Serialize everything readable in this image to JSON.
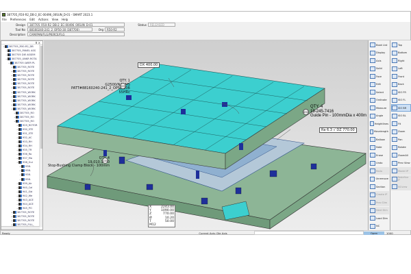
{
  "window": {
    "title": "387705_R50-R2_DB-2_EC-00496_00SUN_D-01 - SMART 2023.1"
  },
  "menu": [
    "File",
    "Preferences",
    "Edit",
    "Actions",
    "View",
    "Help"
  ],
  "form": {
    "design_label": "Design",
    "design": "387705_R50-R2_DB-2_EC-00496_00SUN_D-01",
    "toolno_label": "Tool No",
    "toolno": "88160240-241_2_OP50-30 (387700)",
    "org_label": "Org",
    "org": "R50-R2",
    "desc_label": "Description",
    "desc": "CAM/PAN/FLG/PIERCE/FLG",
    "status_label": "Status",
    "status": "RELEASED"
  },
  "tree": {
    "header": "⊼ ×",
    "items": [
      {
        "t": "387705_R50-R2_DB",
        "l": 0
      },
      {
        "t": "387705_PANEL ASS",
        "l": 1
      },
      {
        "t": "387705 DIE ASSEM",
        "l": 1
      },
      {
        "t": "387705_UNKR ROTA",
        "l": 1
      },
      {
        "t": "387705 LWER PL",
        "l": 2
      },
      {
        "t": "387705_ROTE",
        "l": 3
      },
      {
        "t": "387705_ROTE",
        "l": 3
      },
      {
        "t": "387705_ROTE",
        "l": 3
      },
      {
        "t": "387705_ROTE",
        "l": 3
      },
      {
        "t": "387705_ROTE",
        "l": 3
      },
      {
        "t": "387705_ROTE",
        "l": 3
      },
      {
        "t": "387705_WORK",
        "l": 3
      },
      {
        "t": "387705_WORK",
        "l": 3
      },
      {
        "t": "387705_WORK",
        "l": 3
      },
      {
        "t": "387705_WORK",
        "l": 3
      },
      {
        "t": "387705_WORK",
        "l": 3
      },
      {
        "t": "387705_RO",
        "l": 4
      },
      {
        "t": "387705_RO",
        "l": 4
      },
      {
        "t": "387705_RO",
        "l": 4
      },
      {
        "t": "929_ROTOR",
        "l": 5
      },
      {
        "t": "930_STE",
        "l": 5
      },
      {
        "t": "931_STE",
        "l": 5
      },
      {
        "t": "932_AC",
        "l": 5
      },
      {
        "t": "933_RH",
        "l": 5
      },
      {
        "t": "934_RH",
        "l": 5
      },
      {
        "t": "935_TR",
        "l": 5
      },
      {
        "t": "936_Ro",
        "l": 5
      },
      {
        "t": "937_Ma",
        "l": 5
      },
      {
        "t": "938_Gui",
        "l": 5
      },
      {
        "t": "938.",
        "l": 6
      },
      {
        "t": "938.",
        "l": 6
      },
      {
        "t": "938.",
        "l": 6
      },
      {
        "t": "938.",
        "l": 6
      },
      {
        "t": "939_Air",
        "l": 5
      },
      {
        "t": "940_Cal",
        "l": 5
      },
      {
        "t": "941_Sid",
        "l": 5
      },
      {
        "t": "942_We",
        "l": 5
      },
      {
        "t": "943_ACE",
        "l": 5
      },
      {
        "t": "944_ACE",
        "l": 5
      },
      {
        "t": "945_PO",
        "l": 5
      },
      {
        "t": "387705_ROTE",
        "l": 3
      },
      {
        "t": "387705_ROTE",
        "l": 3
      },
      {
        "t": "387705_ROTE",
        "l": 3
      },
      {
        "t": "387705_FILL_",
        "l": 3
      },
      {
        "t": "387705_FILL_",
        "l": 3
      },
      {
        "t": "387705_CAM_",
        "l": 3
      },
      {
        "t": "387705_CAM_",
        "l": 3
      }
    ]
  },
  "viewport": {
    "dim1": "DX 400.00",
    "note1": {
      "qty": "QTY. 1",
      "part": "G2500/NAAMS",
      "desc": "PATT#88160240-241_2_OP50-30B",
      "hard": "55HRc",
      "balloon": "505"
    },
    "note2": {
      "qty": "QTY. 4",
      "part": "19-245-7416",
      "desc": "Guide Pin - 100mmDia x 400m",
      "balloon": "830"
    },
    "note3": {
      "qty": "QTY. 4",
      "part": "19.010.1110",
      "desc": "Stop-Bushing Clamp Block - 100mm",
      "balloon": "134"
    },
    "dim2": {
      "ra": "Ra 6.3",
      "dz": "DZ 770.00"
    },
    "coords": [
      {
        "k": "X",
        "v": "2243.00"
      },
      {
        "k": "Y",
        "v": "1090.00"
      },
      {
        "k": "Z",
        "v": "770.00"
      },
      {
        "k": "Ø",
        "v": "10.20"
      },
      {
        "k": "T",
        "v": "50.00"
      },
      {
        "k": "M12",
        "v": ""
      }
    ]
  },
  "toolbar_left": [
    {
      "label": "Book List",
      "icon": "book-list-icon"
    },
    {
      "label": "Display",
      "icon": "display-icon"
    },
    {
      "label": "Axis",
      "icon": "axis-icon"
    },
    {
      "label": "Solid",
      "icon": "solid-icon"
    },
    {
      "label": "Face",
      "icon": "face-icon"
    },
    {
      "label": "Edit",
      "icon": "edit-icon"
    },
    {
      "label": "Select",
      "icon": "select-icon"
    },
    {
      "label": "Ordinate",
      "icon": "ordinate-icon"
    },
    {
      "label": "Measure",
      "icon": "measure-icon"
    },
    {
      "label": "Angle",
      "icon": "angle-icon"
    },
    {
      "label": "Heightlines",
      "icon": "heightlines-icon"
    },
    {
      "label": "Movelength",
      "icon": "movelength-icon"
    },
    {
      "label": "Balloon",
      "icon": "balloon-icon"
    },
    {
      "label": "Note",
      "icon": "note-icon"
    },
    {
      "label": "Erase",
      "icon": "erase-icon"
    },
    {
      "label": "Undo",
      "icon": "undo-icon"
    },
    {
      "label": "Redo",
      "icon": "redo-icon",
      "disabled": true
    },
    {
      "label": "Unremove",
      "icon": "unremove-icon"
    },
    {
      "label": "Section",
      "icon": "section-icon"
    },
    {
      "label": "Create IP",
      "icon": "create-icon",
      "disabled": true
    },
    {
      "label": "Prev Dim",
      "icon": "prev-dim-icon",
      "disabled": true
    },
    {
      "label": "Next Dim",
      "icon": "next-dim-icon",
      "disabled": true
    },
    {
      "label": "Load Dim",
      "icon": "load-dim-icon"
    },
    {
      "label": "NC",
      "icon": "nc-icon"
    }
  ],
  "toolbar_right": [
    {
      "label": "Top",
      "icon": "view-top-icon"
    },
    {
      "label": "Bottom",
      "icon": "view-bottom-icon"
    },
    {
      "label": "Right",
      "icon": "view-right-icon"
    },
    {
      "label": "Left",
      "icon": "view-left-icon"
    },
    {
      "label": "Front",
      "icon": "view-front-icon"
    },
    {
      "label": "Back",
      "icon": "view-back-icon"
    },
    {
      "label": "ISO FR",
      "icon": "iso-fr-icon"
    },
    {
      "label": "ISO FL",
      "icon": "iso-fl-icon"
    },
    {
      "label": "ISO BR",
      "icon": "iso-br-icon",
      "selected": true
    },
    {
      "label": "ISO BL",
      "icon": "iso-bl-icon"
    },
    {
      "label": "Fit",
      "icon": "fit-icon"
    },
    {
      "label": "Zoom",
      "icon": "zoom-icon"
    },
    {
      "label": "Pan",
      "icon": "pan-icon"
    },
    {
      "label": "Rotate",
      "icon": "rotate-icon"
    },
    {
      "label": "ZoomAll",
      "icon": "zoom-all-icon"
    },
    {
      "label": "Prev View",
      "icon": "prev-view-icon"
    },
    {
      "label": "Model IP",
      "icon": "model-icon",
      "disabled": true
    },
    {
      "label": "Redefine IP",
      "icon": "redefine-icon",
      "disabled": true
    },
    {
      "label": "NCview",
      "icon": "ncview-icon",
      "disabled": true
    }
  ],
  "status": {
    "left": "Ready",
    "axis": "Current Axis: Die Axis",
    "mode": "Open",
    "value": "1000"
  },
  "colors": {
    "model_top": "#3ccfcf",
    "model_side": "#8db596",
    "accent": "#3a7bd5"
  }
}
